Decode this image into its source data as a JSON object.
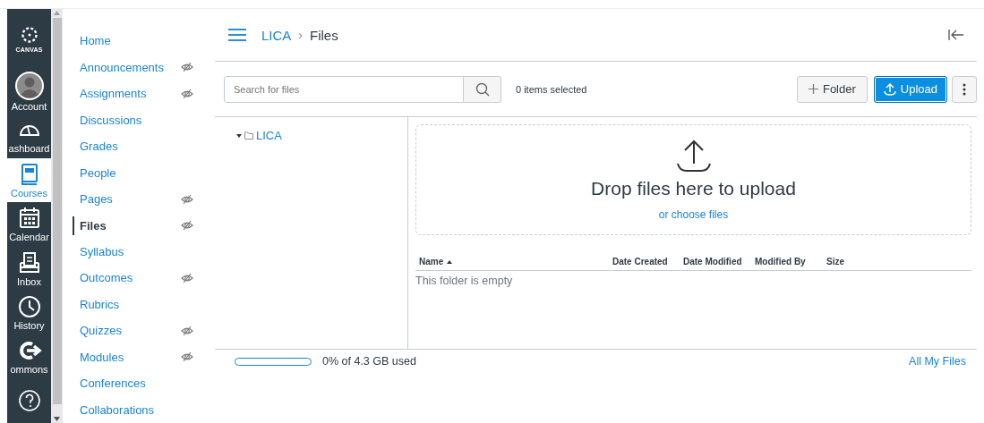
{
  "global_nav": {
    "logo": "CANVAS",
    "items": [
      {
        "kind": "avatar",
        "label": "Account",
        "selected": false
      },
      {
        "kind": "dashboard",
        "label": "ashboard",
        "selected": false
      },
      {
        "kind": "courses",
        "label": "Courses",
        "selected": true
      },
      {
        "kind": "calendar",
        "label": "Calendar",
        "selected": false
      },
      {
        "kind": "inbox",
        "label": "Inbox",
        "selected": false
      },
      {
        "kind": "history",
        "label": "History",
        "selected": false
      },
      {
        "kind": "commons",
        "label": "ommons",
        "selected": false
      },
      {
        "kind": "help",
        "selected": false
      }
    ]
  },
  "course_nav": {
    "items": [
      {
        "label": "Home",
        "hidden": false,
        "selected": false
      },
      {
        "label": "Announcements",
        "hidden": true,
        "selected": false
      },
      {
        "label": "Assignments",
        "hidden": true,
        "selected": false
      },
      {
        "label": "Discussions",
        "hidden": false,
        "selected": false
      },
      {
        "label": "Grades",
        "hidden": false,
        "selected": false
      },
      {
        "label": "People",
        "hidden": false,
        "selected": false
      },
      {
        "label": "Pages",
        "hidden": true,
        "selected": false
      },
      {
        "label": "Files",
        "hidden": true,
        "selected": true
      },
      {
        "label": "Syllabus",
        "hidden": false,
        "selected": false
      },
      {
        "label": "Outcomes",
        "hidden": true,
        "selected": false
      },
      {
        "label": "Rubrics",
        "hidden": false,
        "selected": false
      },
      {
        "label": "Quizzes",
        "hidden": true,
        "selected": false
      },
      {
        "label": "Modules",
        "hidden": true,
        "selected": false
      },
      {
        "label": "Conferences",
        "hidden": false,
        "selected": false
      },
      {
        "label": "Collaborations",
        "hidden": false,
        "selected": false
      }
    ]
  },
  "breadcrumb": [
    "LICA",
    "Files"
  ],
  "breadcrumb_separator": "›",
  "toolbar": {
    "search": {
      "placeholder": "Search for files"
    },
    "selection": "0 items selected",
    "folder_button": "Folder",
    "upload_button": "Upload"
  },
  "tree": [
    {
      "label": "LICA",
      "expanded": true
    }
  ],
  "dropzone": {
    "title": "Drop files here to upload",
    "link": "or choose files"
  },
  "table": {
    "columns": [
      {
        "label": "Name",
        "sorted": true
      },
      {
        "label": "Date Created",
        "sorted": false
      },
      {
        "label": "Date Modified",
        "sorted": false
      },
      {
        "label": "Modified By",
        "sorted": false
      },
      {
        "label": "Size",
        "sorted": false
      }
    ],
    "empty": "This folder is empty"
  },
  "footer": {
    "usage": {
      "level": 0
    },
    "usage_text": "0% of 4.3 GB used",
    "link": "All My Files"
  }
}
